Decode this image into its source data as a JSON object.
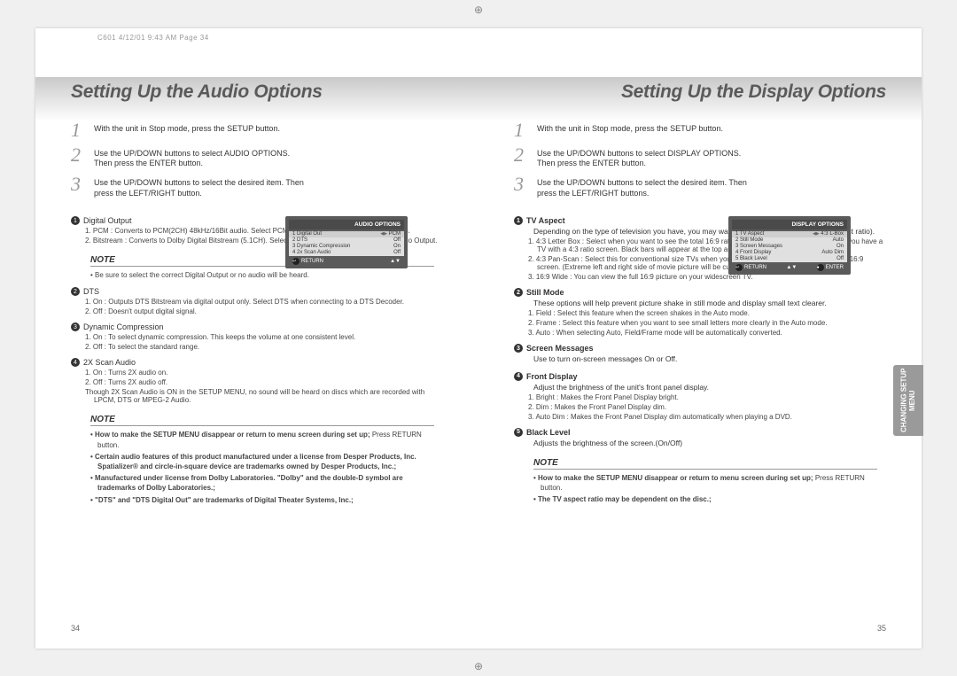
{
  "print_header": "C601  4/12/01 9:43 AM  Page 34",
  "left": {
    "title": "Setting Up the Audio Options",
    "steps": [
      {
        "num": "1",
        "text": "With the unit in Stop mode, press the SETUP button."
      },
      {
        "num": "2",
        "text": "Use the UP/DOWN buttons to select AUDIO OPTIONS. Then press the ENTER button."
      },
      {
        "num": "3",
        "text": "Use the UP/DOWN buttons to select the desired item. Then press the LEFT/RIGHT button."
      }
    ],
    "osd": {
      "title": "AUDIO OPTIONS",
      "rows": [
        {
          "l": "1 Digital Out",
          "r": "PCM",
          "sel": true,
          "arrows": true
        },
        {
          "l": "2 DTS",
          "r": "Off"
        },
        {
          "l": "3 Dynamic Compression",
          "r": "On"
        },
        {
          "l": "4 2x Scan Audio",
          "r": "Off"
        }
      ],
      "footer": {
        "return": "RETURN",
        "arrows": "▲▼"
      }
    },
    "details": [
      {
        "num": "1",
        "title": "Digital Output",
        "items": [
          "1. PCM : Converts to PCM(2CH) 48kHz/16Bit audio. Select PCM when using the Analog Audio Outputs.",
          "2. Bitstream : Converts to Dolby Digital Bitstream (5.1CH). Select Bitstream when using the Digital Audio Output."
        ]
      },
      {
        "_notebreak": true,
        "note": [
          "Be sure to select the correct Digital Output or no audio will be heard."
        ]
      },
      {
        "num": "2",
        "title": "DTS",
        "items": [
          "1. On : Outputs DTS Bitstream via digital output only. Select DTS when connecting to a DTS Decoder.",
          "2. Off : Doesn't output digital signal."
        ]
      },
      {
        "num": "3",
        "title": "Dynamic Compression",
        "items": [
          "1. On : To select dynamic compression. This keeps the volume at one consistent level.",
          "2. Off : To select the standard range."
        ]
      },
      {
        "num": "4",
        "title": "2X Scan Audio",
        "items": [
          "1. On : Turns 2X audio on.",
          "2. Off : Turns 2X audio off.",
          "Though 2X Scan Audio is ON in the SETUP MENU, no sound will be heard on discs which are recorded with LPCM, DTS or MPEG-2 Audio."
        ]
      }
    ],
    "final_note": [
      "• How to make the SETUP MENU disappear or return to menu screen during set up; Press RETURN button.",
      "• Certain audio features of this product manufactured under a license from Desper Products, Inc. Spatializer® and circle-in-square device are trademarks owned by Desper Products, Inc.",
      "• Manufactured under license from Dolby Laboratories. \"Dolby\" and the double-D symbol are trademarks of Dolby Laboratories.",
      "• \"DTS\" and \"DTS Digital Out\" are trademarks of Digital Theater Systems, Inc."
    ],
    "page_num": "34"
  },
  "right": {
    "title": "Setting Up the Display Options",
    "steps": [
      {
        "num": "1",
        "text": "With the unit in Stop mode, press the SETUP button."
      },
      {
        "num": "2",
        "text": "Use the UP/DOWN buttons to select DISPLAY OPTIONS. Then press the ENTER button."
      },
      {
        "num": "3",
        "text": "Use the UP/DOWN buttons to select the desired item. Then press the LEFT/RIGHT buttons."
      }
    ],
    "osd": {
      "title": "DISPLAY OPTIONS",
      "rows": [
        {
          "l": "1 TV Aspect",
          "r": "4:3  L-Box",
          "sel": true,
          "arrows": true
        },
        {
          "l": "2 Still Mode",
          "r": "Auto"
        },
        {
          "l": "3 Screen Messages",
          "r": "On"
        },
        {
          "l": "4 Front Display",
          "r": "Auto Dim"
        },
        {
          "l": "5 Black Level",
          "r": "Off"
        }
      ],
      "footer": {
        "return": "RETURN",
        "arrows": "▲▼",
        "enter": "ENTER"
      }
    },
    "details": [
      {
        "num": "1",
        "title": "TV Aspect",
        "bold": true,
        "lead": "Depending on the type of television you have, you may want to adjust the screen setting (aspect ratio).",
        "items": [
          "1. 4:3 Letter Box : Select when you want to see the total 16:9 ratio screen DVD supplies, even though you have a TV with a 4:3 ratio screen. Black bars will appear at the top and bottom of the screen.",
          "2. 4:3 Pan-Scan : Select this for conventional size TVs when you want to see the central portion of the 16:9 screen. (Extreme left and right side of movie picture will be cut off.)",
          "3. 16:9 Wide : You can view the full 16:9 picture on your widescreen TV."
        ]
      },
      {
        "num": "2",
        "title": "Still Mode",
        "bold": true,
        "lead": "These options will help prevent picture shake in still mode and display small text clearer.",
        "items": [
          "1. Field : Select this feature when the screen shakes in the Auto mode.",
          "2. Frame : Select this feature when you want to see small letters more clearly in the Auto mode.",
          "3. Auto : When selecting Auto, Field/Frame mode will be automatically converted."
        ]
      },
      {
        "num": "3",
        "title": "Screen Messages",
        "bold": true,
        "lead": "Use to turn on-screen messages On or Off."
      },
      {
        "num": "4",
        "title": "Front Display",
        "bold": true,
        "lead": "Adjust the brightness of the unit's front panel display.",
        "items": [
          "1. Bright : Makes the Front Panel Display bright.",
          "2. Dim : Makes the Front Panel Display dim.",
          "3. Auto Dim : Makes the Front Panel Display dim automatically when playing a DVD."
        ]
      },
      {
        "num": "5",
        "title": "Black Level",
        "bold": true,
        "lead": "Adjusts the brightness of the screen.(On/Off)"
      }
    ],
    "final_note": [
      "• How to make the SETUP MENU disappear or return to menu screen during set up; Press RETURN button.",
      "• The TV aspect ratio may be dependent on the disc."
    ],
    "page_num": "35",
    "side_tab": "CHANGING SETUP MENU"
  },
  "note_label": "NOTE"
}
